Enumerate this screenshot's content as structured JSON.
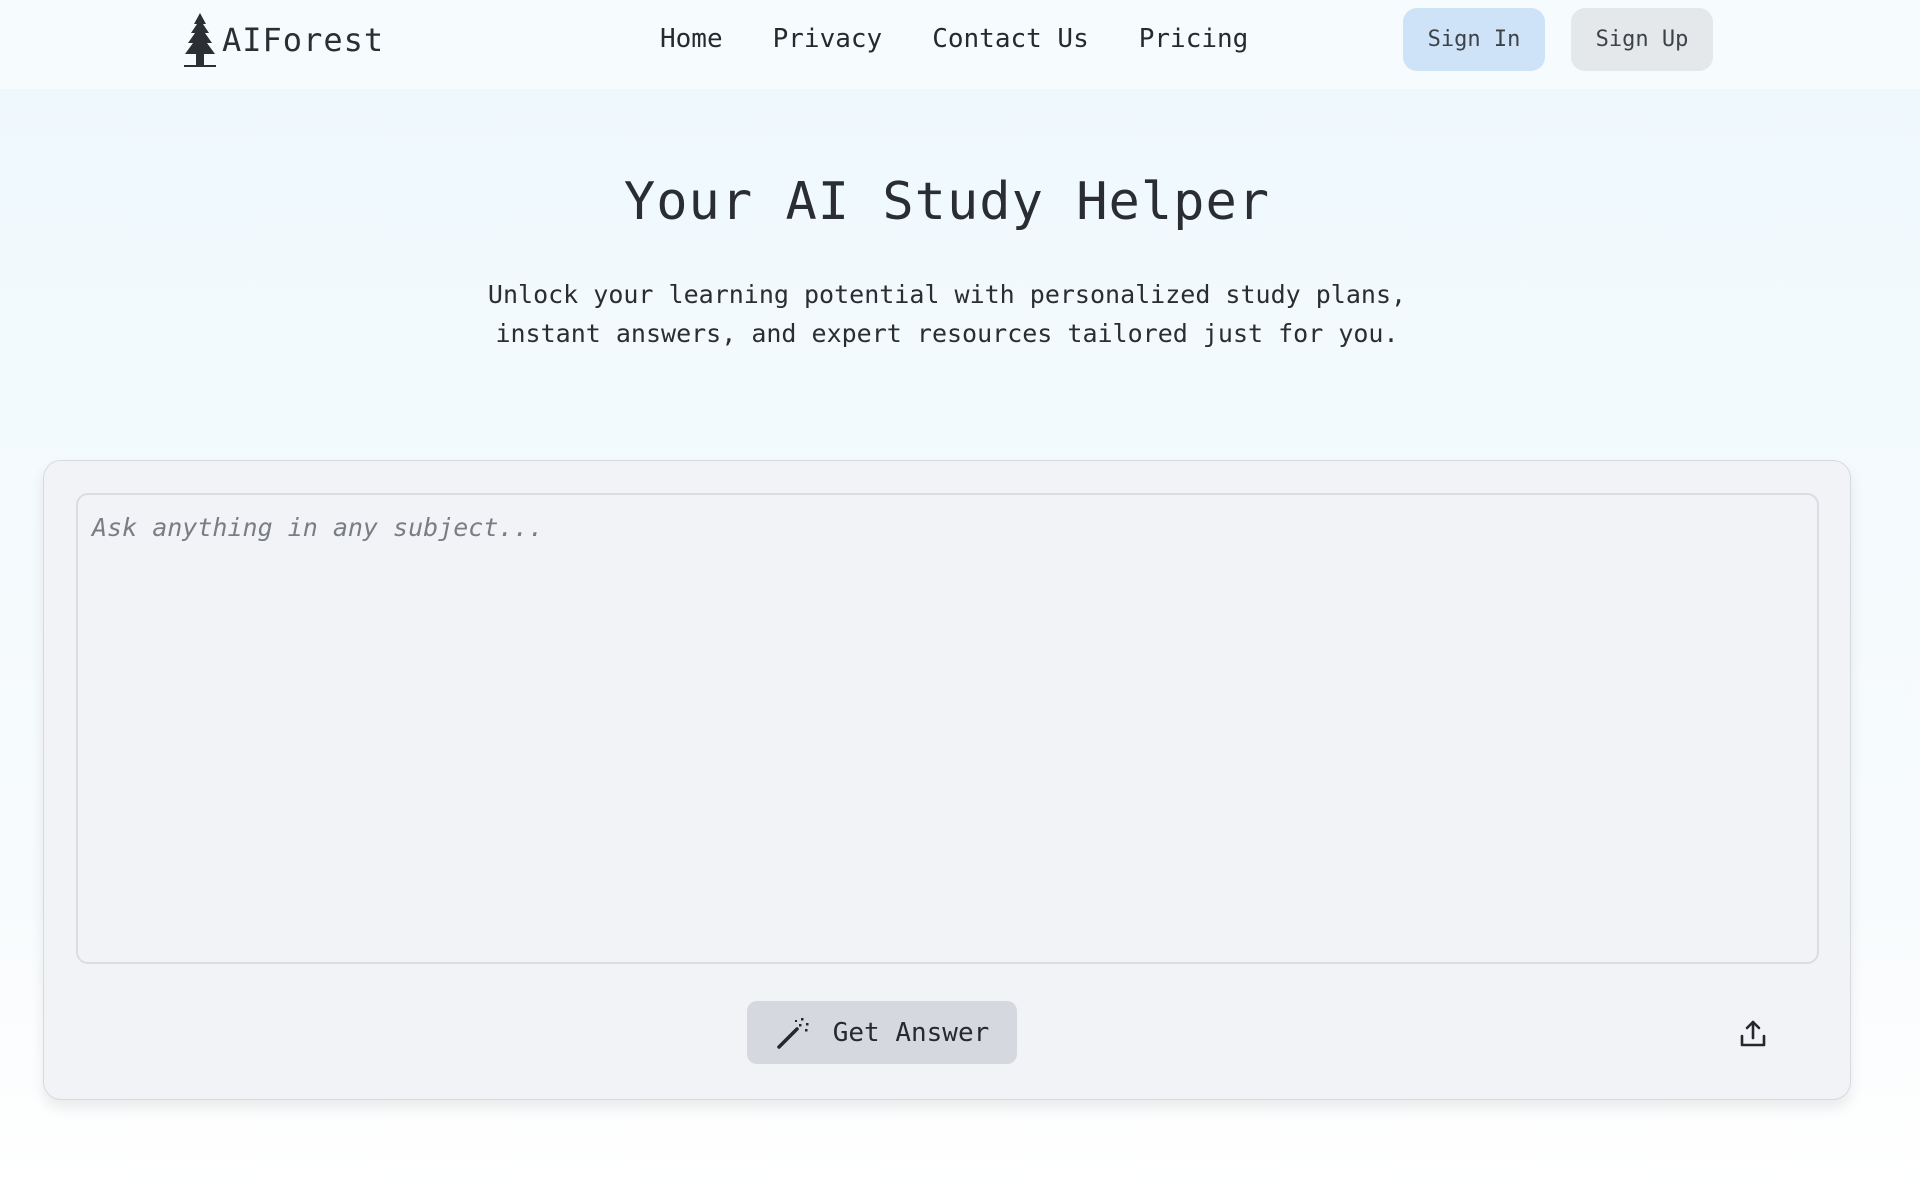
{
  "header": {
    "brand": {
      "name": "AIForest",
      "logo_icon": "pine-tree-icon"
    },
    "nav": [
      {
        "label": "Home"
      },
      {
        "label": "Privacy"
      },
      {
        "label": "Contact Us"
      },
      {
        "label": "Pricing"
      }
    ],
    "sign_in_label": "Sign In",
    "sign_up_label": "Sign Up"
  },
  "hero": {
    "title": "Your AI Study Helper",
    "subtitle": "Unlock your learning potential with personalized study plans, instant answers, and expert resources tailored just for you."
  },
  "question_card": {
    "input_value": "",
    "input_placeholder": "Ask anything in any subject...",
    "submit_label": "Get Answer",
    "submit_icon": "magic-wand-icon",
    "upload_icon": "upload-icon"
  },
  "colors": {
    "sign_in_bg": "#cfe3f8",
    "sign_up_bg": "#e5e8eb",
    "card_bg": "#f1f3f7",
    "submit_bg": "#d5d8de",
    "text": "#24272c"
  }
}
